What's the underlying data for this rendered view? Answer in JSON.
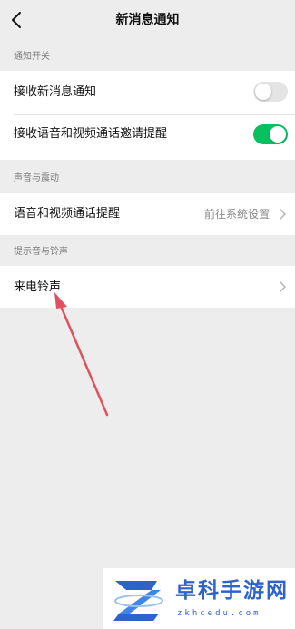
{
  "navbar": {
    "title": "新消息通知",
    "back_icon": "chevron-left-icon"
  },
  "sections": [
    {
      "label": "通知开关",
      "rows": [
        {
          "label": "接收新消息通知",
          "control": "toggle",
          "state": "off"
        },
        {
          "label": "接收语音和视频通话邀请提醒",
          "control": "toggle",
          "state": "on"
        }
      ]
    },
    {
      "label": "声音与震动",
      "rows": [
        {
          "label": "语音和视频通话提醒",
          "value": "前往系统设置",
          "control": "chevron"
        }
      ]
    },
    {
      "label": "提示音与铃声",
      "rows": [
        {
          "label": "来电铃声",
          "control": "chevron"
        }
      ]
    }
  ],
  "colors": {
    "background": "#ededed",
    "toggle_on": "#07c160",
    "toggle_off": "#e4e4e4",
    "annotation_arrow": "#e0505f",
    "watermark_brand": "#2f63c9"
  },
  "watermark": {
    "title": "卓科手游网",
    "url": "zkhcedu.com"
  }
}
